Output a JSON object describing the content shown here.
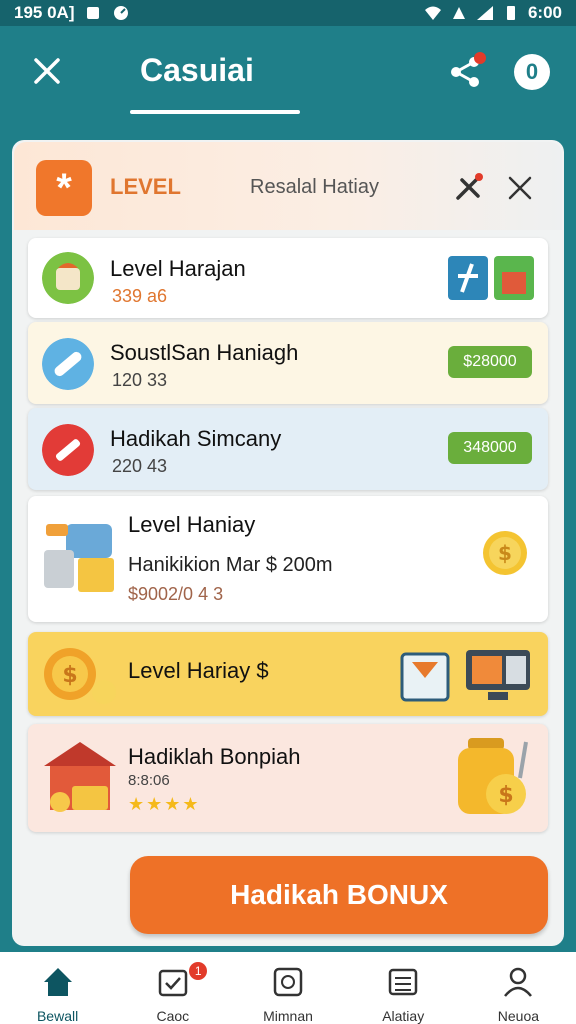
{
  "status_bar": {
    "time_left": "195 0A]",
    "time_right": "6:00"
  },
  "app_bar": {
    "title": "Casuiai",
    "info_label": "0"
  },
  "panel_header": {
    "icon_glyph": "*",
    "label": "LEVEL",
    "subtitle": "Resalal Hatiay"
  },
  "items": [
    {
      "title": "Level Harajan",
      "subtitle": "339 a6"
    },
    {
      "title": "SoustlSan Haniagh",
      "subtitle": "120 33",
      "amount": "$28000"
    },
    {
      "title": "Hadikah Simcany",
      "subtitle": "220 43",
      "amount": "348000"
    },
    {
      "title": "Level Haniay",
      "line2": "Hanikikion Mar $ 200m",
      "line3": "$9002/0 4 3"
    },
    {
      "title": "Level Hariay $"
    },
    {
      "title": "Hadiklah Bonpiah",
      "subtitle": "8:8:06",
      "rating": 4
    }
  ],
  "bonus_button": "Hadikah BONUX",
  "bottom_nav": [
    {
      "label": "Bewall",
      "icon": "home-icon"
    },
    {
      "label": "Caoc",
      "icon": "check-icon",
      "badge": "1"
    },
    {
      "label": "Mimnan",
      "icon": "clock-icon"
    },
    {
      "label": "Alatiay",
      "icon": "list-icon"
    },
    {
      "label": "Neuoa",
      "icon": "user-icon"
    }
  ],
  "colors": {
    "primary": "#1f7f89",
    "accent": "#ee7127",
    "green": "#6aae3c"
  }
}
